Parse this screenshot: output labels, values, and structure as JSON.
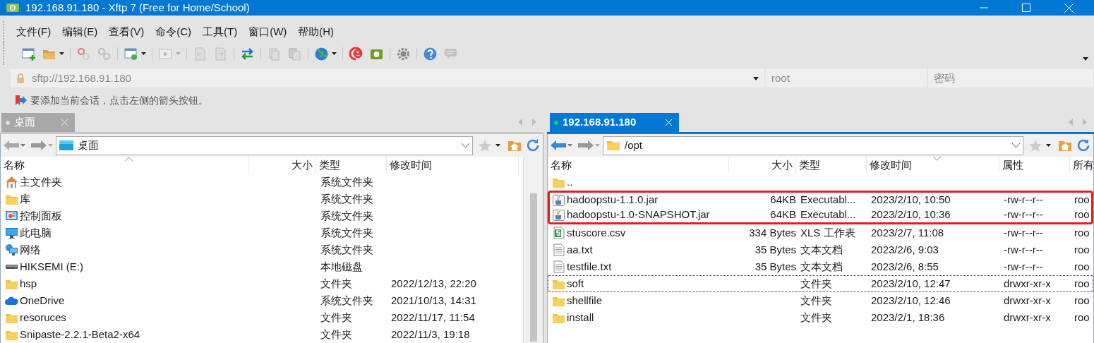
{
  "window": {
    "title": "192.168.91.180 - Xftp 7 (Free for Home/School)"
  },
  "menu": [
    "文件(F)",
    "编辑(E)",
    "查看(V)",
    "命令(C)",
    "工具(T)",
    "窗口(W)",
    "帮助(H)"
  ],
  "address_bar": {
    "value": "sftp://192.168.91.180",
    "user_placeholder": "root",
    "password_placeholder": "密码"
  },
  "info": "要添加当前会话，点击左侧的箭头按钮。",
  "panes": [
    {
      "tab": {
        "label": "桌面",
        "selected": false,
        "connected": false
      },
      "path": "桌面",
      "path_is_desktop": true,
      "columns": [
        {
          "label": "名称",
          "sorted": true,
          "descending": false
        },
        {
          "label": "大小",
          "sorted": false
        },
        {
          "label": "类型",
          "sorted": false
        },
        {
          "label": "修改时间",
          "sorted": false
        }
      ],
      "rows": [
        {
          "kind": "home",
          "cells": [
            "主文件夹",
            "",
            "系统文件夹",
            ""
          ],
          "highlighted": false,
          "focused": false
        },
        {
          "kind": "folder",
          "cells": [
            "库",
            "",
            "系统文件夹",
            ""
          ],
          "highlighted": false,
          "focused": false
        },
        {
          "kind": "control",
          "cells": [
            "控制面板",
            "",
            "系统文件夹",
            ""
          ],
          "highlighted": false,
          "focused": false
        },
        {
          "kind": "computer",
          "cells": [
            "此电脑",
            "",
            "系统文件夹",
            ""
          ],
          "highlighted": false,
          "focused": false
        },
        {
          "kind": "network",
          "cells": [
            "网络",
            "",
            "系统文件夹",
            ""
          ],
          "highlighted": false,
          "focused": false
        },
        {
          "kind": "drive",
          "cells": [
            "HIKSEMI (E:)",
            "",
            "本地磁盘",
            ""
          ],
          "highlighted": false,
          "focused": false
        },
        {
          "kind": "folder",
          "cells": [
            "hsp",
            "",
            "文件夹",
            "2022/12/13, 22:20"
          ],
          "highlighted": false,
          "focused": false
        },
        {
          "kind": "cloud",
          "cells": [
            "OneDrive",
            "",
            "系统文件夹",
            "2021/10/13, 14:31"
          ],
          "highlighted": false,
          "focused": false
        },
        {
          "kind": "folder",
          "cells": [
            "resoruces",
            "",
            "文件夹",
            "2022/11/17, 11:54"
          ],
          "highlighted": false,
          "focused": false
        },
        {
          "kind": "folder",
          "cells": [
            "Snipaste-2.2.1-Beta2-x64",
            "",
            "文件夹",
            "2022/11/3, 19:18"
          ],
          "highlighted": false,
          "focused": false
        }
      ]
    },
    {
      "tab": {
        "label": "192.168.91.180",
        "selected": true,
        "connected": true
      },
      "path": "/opt",
      "path_is_desktop": false,
      "columns": [
        {
          "label": "名称",
          "sorted": false
        },
        {
          "label": "大小",
          "sorted": false
        },
        {
          "label": "类型",
          "sorted": false
        },
        {
          "label": "修改时间",
          "sorted": true,
          "descending": true
        },
        {
          "label": "属性",
          "sorted": false
        },
        {
          "label": "所有",
          "sorted": false
        }
      ],
      "rows": [
        {
          "kind": "folder",
          "cells": [
            "..",
            "",
            "",
            "",
            "",
            ""
          ],
          "highlighted": false,
          "focused": false
        },
        {
          "kind": "jar",
          "cells": [
            "hadoopstu-1.1.0.jar",
            "64KB",
            "Executabl...",
            "2023/2/10, 10:50",
            "-rw-r--r--",
            "roo"
          ],
          "highlighted": true,
          "focused": false
        },
        {
          "kind": "jar",
          "cells": [
            "hadoopstu-1.0-SNAPSHOT.jar",
            "64KB",
            "Executabl...",
            "2023/2/10, 10:36",
            "-rw-r--r--",
            "roo"
          ],
          "highlighted": true,
          "focused": false
        },
        {
          "kind": "sheet",
          "cells": [
            "stuscore.csv",
            "334 Bytes",
            "XLS 工作表",
            "2023/2/7, 11:08",
            "-rw-r--r--",
            "roo"
          ],
          "highlighted": false,
          "focused": false
        },
        {
          "kind": "text",
          "cells": [
            "aa.txt",
            "35 Bytes",
            "文本文档",
            "2023/2/6, 9:03",
            "-rw-r--r--",
            "roo"
          ],
          "highlighted": false,
          "focused": false
        },
        {
          "kind": "text",
          "cells": [
            "testfile.txt",
            "35 Bytes",
            "文本文档",
            "2023/2/6, 8:55",
            "-rw-r--r--",
            "roo"
          ],
          "highlighted": false,
          "focused": false
        },
        {
          "kind": "folder",
          "cells": [
            "soft",
            "",
            "文件夹",
            "2023/2/10, 12:47",
            "drwxr-xr-x",
            "roo"
          ],
          "highlighted": false,
          "focused": true
        },
        {
          "kind": "folder",
          "cells": [
            "shellfile",
            "",
            "文件夹",
            "2023/2/10, 12:46",
            "drwxr-xr-x",
            "roo"
          ],
          "highlighted": false,
          "focused": false
        },
        {
          "kind": "folder",
          "cells": [
            "install",
            "",
            "文件夹",
            "2023/2/1, 18:36",
            "drwxr-xr-x",
            "roo"
          ],
          "highlighted": false,
          "focused": false
        }
      ]
    }
  ]
}
